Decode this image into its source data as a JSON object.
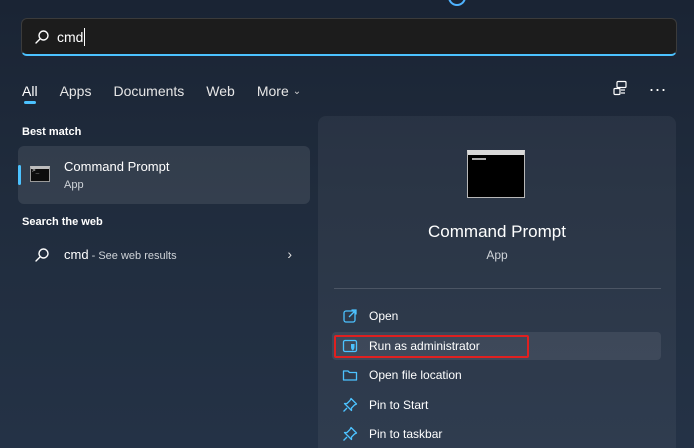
{
  "search": {
    "value": "cmd"
  },
  "tabs": [
    {
      "label": "All",
      "active": true
    },
    {
      "label": "Apps"
    },
    {
      "label": "Documents"
    },
    {
      "label": "Web"
    },
    {
      "label": "More"
    }
  ],
  "tools": {
    "connect_icon": "connected-devices-icon",
    "more_icon": "ellipsis-icon"
  },
  "best_match": {
    "section": "Best match",
    "title": "Command Prompt",
    "subtitle": "App"
  },
  "web_search": {
    "section": "Search the web",
    "query": "cmd",
    "suffix": " - See web results"
  },
  "preview": {
    "title": "Command Prompt",
    "subtitle": "App",
    "actions": [
      {
        "label": "Open",
        "icon": "open-external-icon"
      },
      {
        "label": "Run as administrator",
        "icon": "shield-icon",
        "highlighted": true
      },
      {
        "label": "Open file location",
        "icon": "folder-icon"
      },
      {
        "label": "Pin to Start",
        "icon": "pin-icon"
      },
      {
        "label": "Pin to taskbar",
        "icon": "pin-icon"
      }
    ]
  },
  "colors": {
    "accent": "#4cc2ff",
    "highlight": "#e02020"
  }
}
